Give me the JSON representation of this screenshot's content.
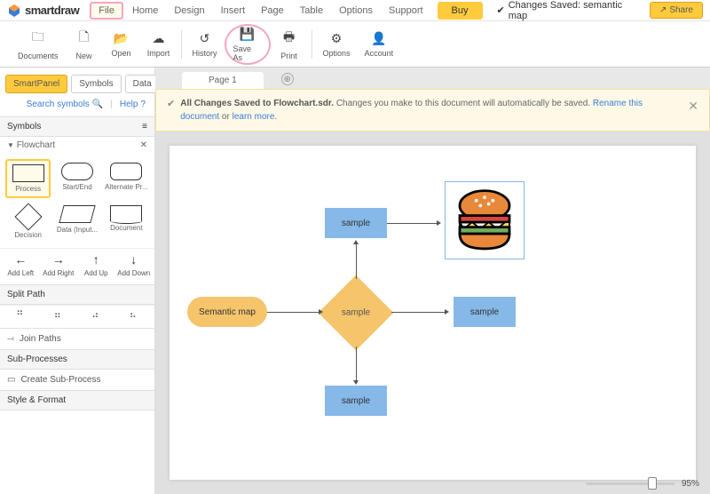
{
  "logo": "smartdraw",
  "menu": [
    "File",
    "Home",
    "Design",
    "Insert",
    "Page",
    "Table",
    "Options",
    "Support"
  ],
  "buy": "Buy",
  "status": "Changes Saved: semantic map",
  "share": "Share",
  "toolbar": [
    {
      "icon": "folder",
      "label": "Documents"
    },
    {
      "icon": "file",
      "label": "New"
    },
    {
      "icon": "open",
      "label": "Open"
    },
    {
      "icon": "cloud",
      "label": "Import"
    },
    {
      "icon": "history",
      "label": "History"
    },
    {
      "icon": "save",
      "label": "Save As"
    },
    {
      "icon": "print",
      "label": "Print"
    },
    {
      "icon": "gear",
      "label": "Options"
    },
    {
      "icon": "user",
      "label": "Account"
    }
  ],
  "panel": {
    "tabs": [
      "SmartPanel",
      "Symbols",
      "Data"
    ],
    "search": "Search symbols",
    "help": "Help"
  },
  "symbols": {
    "header": "Symbols",
    "group": "Flowchart",
    "shapes": [
      {
        "label": "Process"
      },
      {
        "label": "Start/End"
      },
      {
        "label": "Alternate Pr..."
      },
      {
        "label": "Decision"
      },
      {
        "label": "Data (Input..."
      },
      {
        "label": "Document"
      }
    ]
  },
  "arrows": [
    {
      "label": "Add Left"
    },
    {
      "label": "Add Right"
    },
    {
      "label": "Add Up"
    },
    {
      "label": "Add Down"
    }
  ],
  "sections": {
    "split": "Split Path",
    "join": "Join Paths",
    "sub": "Sub-Processes",
    "createsub": "Create Sub-Process",
    "style": "Style & Format"
  },
  "page_tab": "Page 1",
  "notice": {
    "bold": "All Changes Saved to Flowchart.sdr.",
    "text": " Changes you make to this document will automatically be saved. ",
    "link1": "Rename this document",
    "or": " or ",
    "link2": "learn more",
    "dot": "."
  },
  "nodes": {
    "semantic": "Semantic map",
    "sample": "sample"
  },
  "zoom": "95%"
}
